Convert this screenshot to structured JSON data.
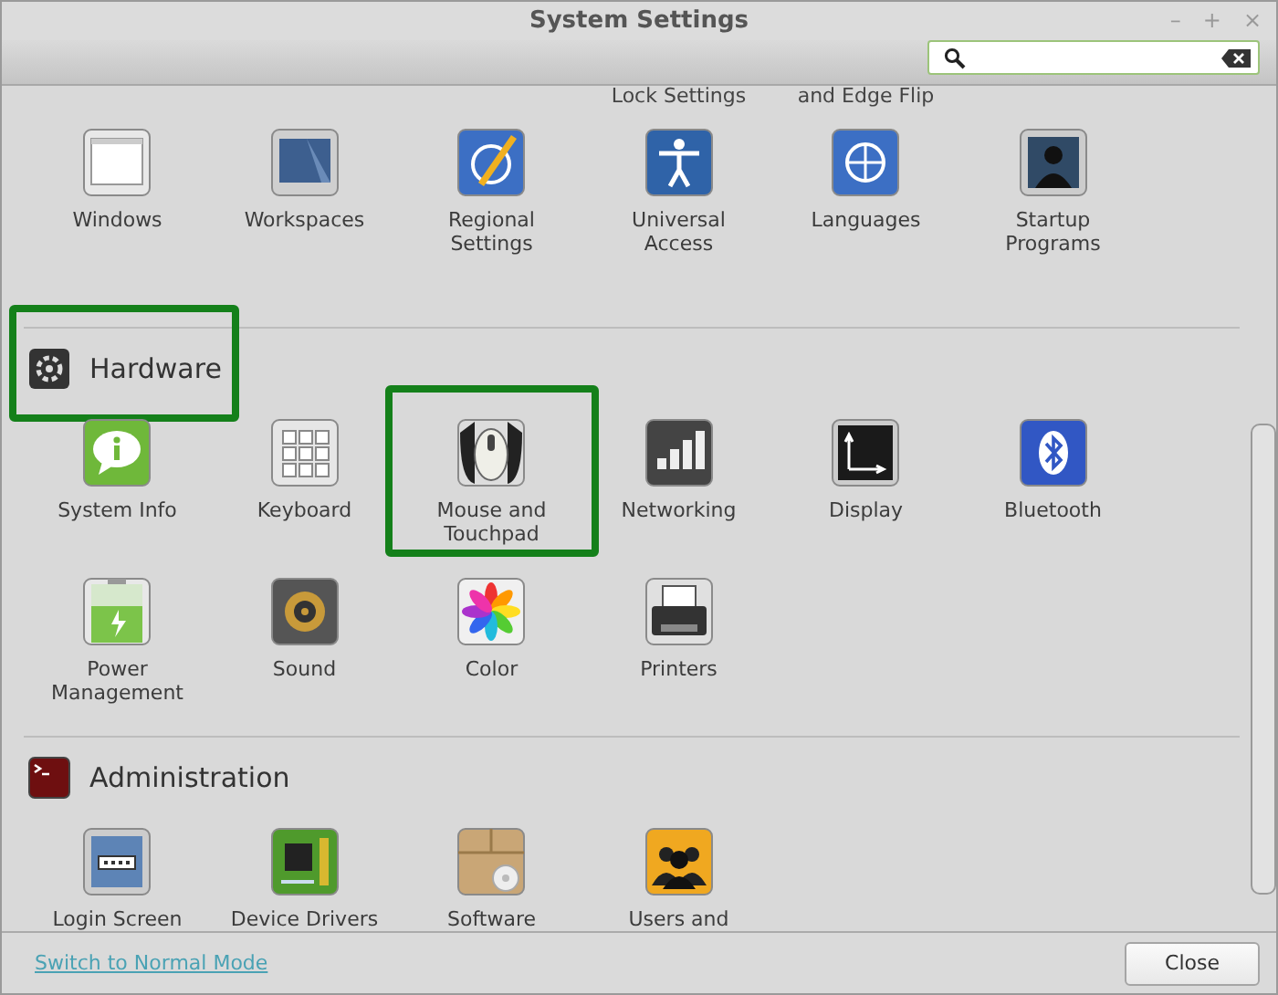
{
  "window": {
    "title": "System Settings",
    "controls": [
      "–",
      "+",
      "×"
    ]
  },
  "partial_row": [
    "Lock Settings",
    "and Edge Flip"
  ],
  "sections": [
    {
      "items": [
        {
          "label": "Windows",
          "highlighted": false
        },
        {
          "label": "Workspaces",
          "highlighted": false
        },
        {
          "label": "Regional Settings",
          "highlighted": false
        },
        {
          "label": "Universal Access",
          "highlighted": false
        },
        {
          "label": "Languages",
          "highlighted": false
        },
        {
          "label": "Startup Programs",
          "highlighted": false
        }
      ]
    },
    {
      "header": "Hardware",
      "highlighted": true,
      "items": [
        {
          "label": "System Info",
          "highlighted": false
        },
        {
          "label": "Keyboard",
          "highlighted": false
        },
        {
          "label": "Mouse and Touchpad",
          "highlighted": true
        },
        {
          "label": "Networking",
          "highlighted": false
        },
        {
          "label": "Display",
          "highlighted": false
        },
        {
          "label": "Bluetooth",
          "highlighted": false
        },
        {
          "label": "Power Management",
          "highlighted": false
        },
        {
          "label": "Sound",
          "highlighted": false
        },
        {
          "label": "Color",
          "highlighted": false
        },
        {
          "label": "Printers",
          "highlighted": false
        }
      ]
    },
    {
      "header": "Administration",
      "highlighted": false,
      "items": [
        {
          "label": "Login Screen",
          "highlighted": false
        },
        {
          "label": "Device Drivers",
          "highlighted": false
        },
        {
          "label": "Software",
          "highlighted": false
        },
        {
          "label": "Users and",
          "highlighted": false
        }
      ]
    }
  ],
  "footer": {
    "link": "Switch to Normal Mode",
    "button": "Close"
  }
}
